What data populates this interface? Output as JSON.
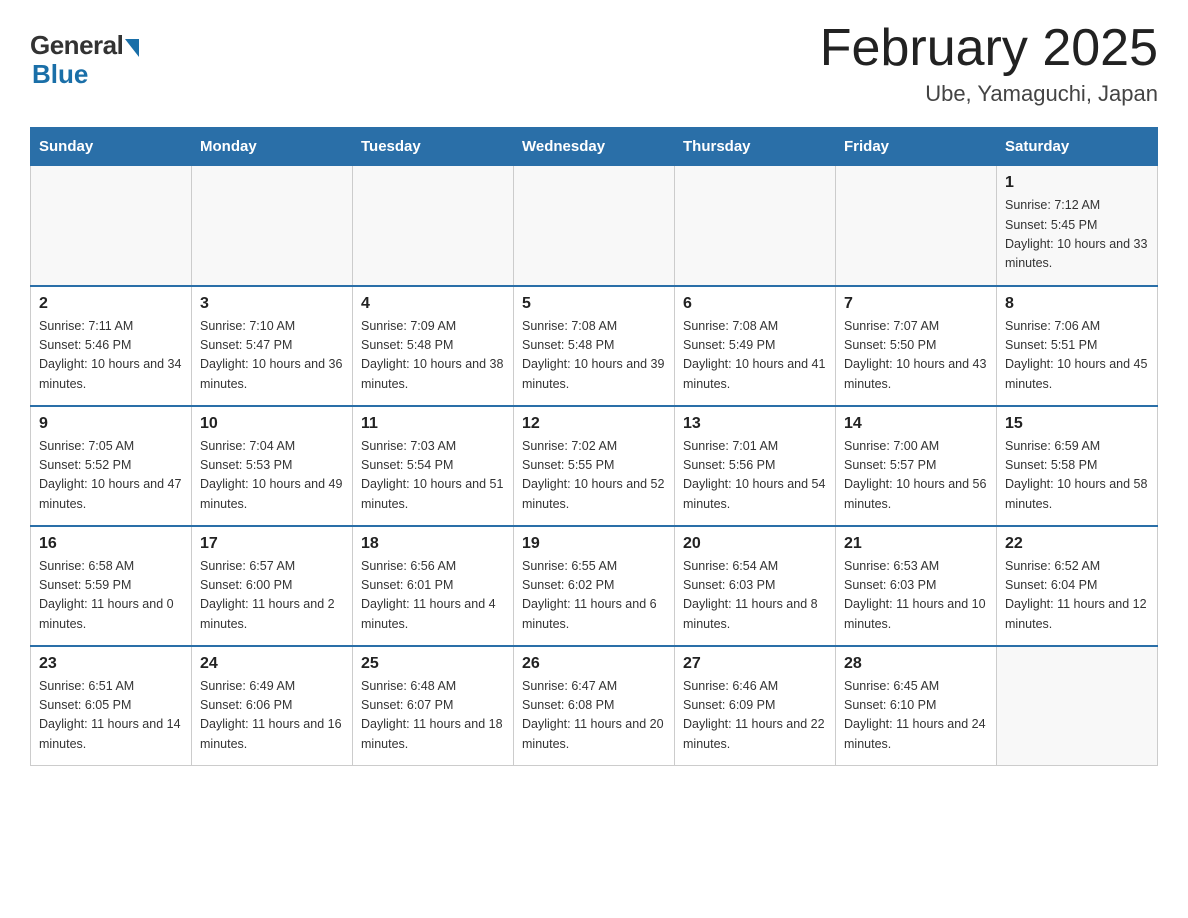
{
  "header": {
    "logo_general": "General",
    "logo_blue": "Blue",
    "title": "February 2025",
    "subtitle": "Ube, Yamaguchi, Japan"
  },
  "days_of_week": [
    "Sunday",
    "Monday",
    "Tuesday",
    "Wednesday",
    "Thursday",
    "Friday",
    "Saturday"
  ],
  "weeks": [
    [
      {
        "day": "",
        "info": ""
      },
      {
        "day": "",
        "info": ""
      },
      {
        "day": "",
        "info": ""
      },
      {
        "day": "",
        "info": ""
      },
      {
        "day": "",
        "info": ""
      },
      {
        "day": "",
        "info": ""
      },
      {
        "day": "1",
        "info": "Sunrise: 7:12 AM\nSunset: 5:45 PM\nDaylight: 10 hours and 33 minutes."
      }
    ],
    [
      {
        "day": "2",
        "info": "Sunrise: 7:11 AM\nSunset: 5:46 PM\nDaylight: 10 hours and 34 minutes."
      },
      {
        "day": "3",
        "info": "Sunrise: 7:10 AM\nSunset: 5:47 PM\nDaylight: 10 hours and 36 minutes."
      },
      {
        "day": "4",
        "info": "Sunrise: 7:09 AM\nSunset: 5:48 PM\nDaylight: 10 hours and 38 minutes."
      },
      {
        "day": "5",
        "info": "Sunrise: 7:08 AM\nSunset: 5:48 PM\nDaylight: 10 hours and 39 minutes."
      },
      {
        "day": "6",
        "info": "Sunrise: 7:08 AM\nSunset: 5:49 PM\nDaylight: 10 hours and 41 minutes."
      },
      {
        "day": "7",
        "info": "Sunrise: 7:07 AM\nSunset: 5:50 PM\nDaylight: 10 hours and 43 minutes."
      },
      {
        "day": "8",
        "info": "Sunrise: 7:06 AM\nSunset: 5:51 PM\nDaylight: 10 hours and 45 minutes."
      }
    ],
    [
      {
        "day": "9",
        "info": "Sunrise: 7:05 AM\nSunset: 5:52 PM\nDaylight: 10 hours and 47 minutes."
      },
      {
        "day": "10",
        "info": "Sunrise: 7:04 AM\nSunset: 5:53 PM\nDaylight: 10 hours and 49 minutes."
      },
      {
        "day": "11",
        "info": "Sunrise: 7:03 AM\nSunset: 5:54 PM\nDaylight: 10 hours and 51 minutes."
      },
      {
        "day": "12",
        "info": "Sunrise: 7:02 AM\nSunset: 5:55 PM\nDaylight: 10 hours and 52 minutes."
      },
      {
        "day": "13",
        "info": "Sunrise: 7:01 AM\nSunset: 5:56 PM\nDaylight: 10 hours and 54 minutes."
      },
      {
        "day": "14",
        "info": "Sunrise: 7:00 AM\nSunset: 5:57 PM\nDaylight: 10 hours and 56 minutes."
      },
      {
        "day": "15",
        "info": "Sunrise: 6:59 AM\nSunset: 5:58 PM\nDaylight: 10 hours and 58 minutes."
      }
    ],
    [
      {
        "day": "16",
        "info": "Sunrise: 6:58 AM\nSunset: 5:59 PM\nDaylight: 11 hours and 0 minutes."
      },
      {
        "day": "17",
        "info": "Sunrise: 6:57 AM\nSunset: 6:00 PM\nDaylight: 11 hours and 2 minutes."
      },
      {
        "day": "18",
        "info": "Sunrise: 6:56 AM\nSunset: 6:01 PM\nDaylight: 11 hours and 4 minutes."
      },
      {
        "day": "19",
        "info": "Sunrise: 6:55 AM\nSunset: 6:02 PM\nDaylight: 11 hours and 6 minutes."
      },
      {
        "day": "20",
        "info": "Sunrise: 6:54 AM\nSunset: 6:03 PM\nDaylight: 11 hours and 8 minutes."
      },
      {
        "day": "21",
        "info": "Sunrise: 6:53 AM\nSunset: 6:03 PM\nDaylight: 11 hours and 10 minutes."
      },
      {
        "day": "22",
        "info": "Sunrise: 6:52 AM\nSunset: 6:04 PM\nDaylight: 11 hours and 12 minutes."
      }
    ],
    [
      {
        "day": "23",
        "info": "Sunrise: 6:51 AM\nSunset: 6:05 PM\nDaylight: 11 hours and 14 minutes."
      },
      {
        "day": "24",
        "info": "Sunrise: 6:49 AM\nSunset: 6:06 PM\nDaylight: 11 hours and 16 minutes."
      },
      {
        "day": "25",
        "info": "Sunrise: 6:48 AM\nSunset: 6:07 PM\nDaylight: 11 hours and 18 minutes."
      },
      {
        "day": "26",
        "info": "Sunrise: 6:47 AM\nSunset: 6:08 PM\nDaylight: 11 hours and 20 minutes."
      },
      {
        "day": "27",
        "info": "Sunrise: 6:46 AM\nSunset: 6:09 PM\nDaylight: 11 hours and 22 minutes."
      },
      {
        "day": "28",
        "info": "Sunrise: 6:45 AM\nSunset: 6:10 PM\nDaylight: 11 hours and 24 minutes."
      },
      {
        "day": "",
        "info": ""
      }
    ]
  ]
}
